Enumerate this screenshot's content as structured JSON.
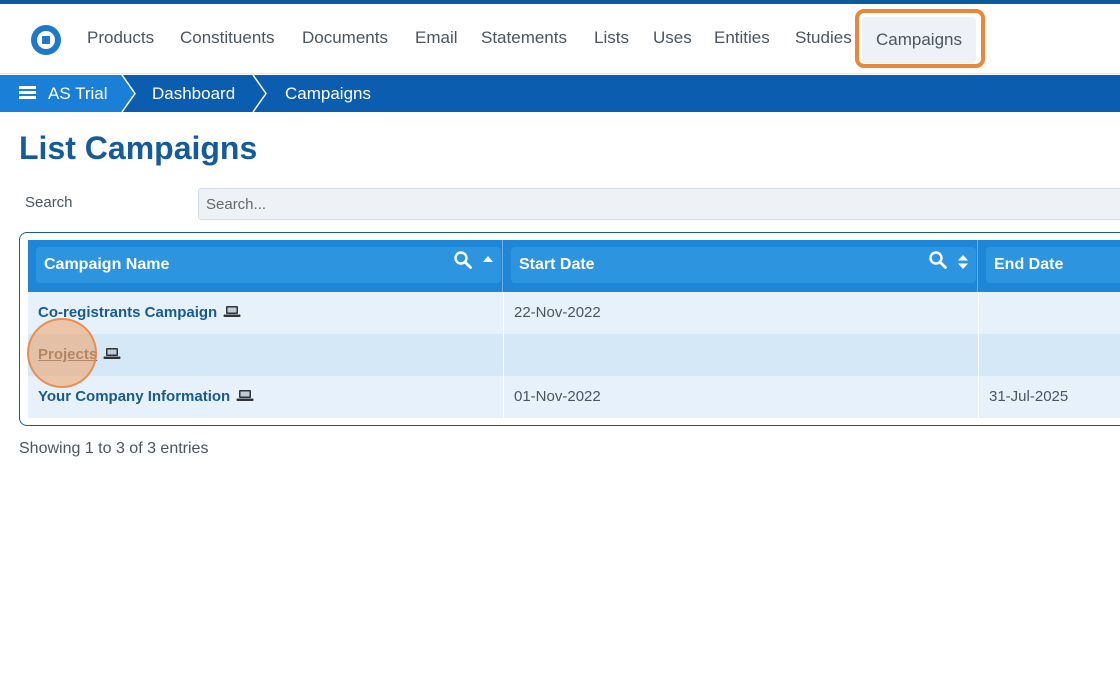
{
  "nav": {
    "items": [
      "Products",
      "Constituents",
      "Documents",
      "Email",
      "Statements",
      "Lists",
      "Uses",
      "Entities",
      "Studies"
    ],
    "active": "Campaigns"
  },
  "breadcrumb": {
    "items": [
      "AS Trial",
      "Dashboard",
      "Campaigns"
    ]
  },
  "page": {
    "title": "List Campaigns"
  },
  "search": {
    "label": "Search",
    "placeholder": "Search..."
  },
  "table": {
    "columns": [
      "Campaign Name",
      "Start Date",
      "End Date"
    ],
    "rows": [
      {
        "name": "Co-registrants Campaign",
        "start": "22-Nov-2022",
        "end": ""
      },
      {
        "name": "Projects",
        "start": "",
        "end": ""
      },
      {
        "name": "Your Company Information",
        "start": "01-Nov-2022",
        "end": "31-Jul-2025"
      }
    ]
  },
  "footer": {
    "info": "Showing 1 to 3 of 3 entries"
  },
  "colors": {
    "brand": "#0b5db0",
    "header": "#1d86d6",
    "highlight": "#e8883a"
  }
}
